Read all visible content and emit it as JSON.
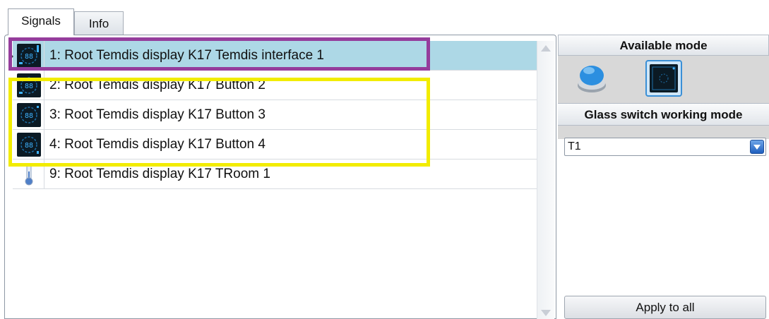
{
  "tabs": {
    "signals": "Signals",
    "info": "Info"
  },
  "signals": [
    {
      "label": "1: Root Temdis display K17 Temdis interface 1",
      "icon": "temdis-display-icon",
      "selected": true
    },
    {
      "label": "2: Root Temdis display K17 Button 2",
      "icon": "temdis-display-icon",
      "selected": false
    },
    {
      "label": "3: Root Temdis display K17 Button 3",
      "icon": "temdis-display-icon",
      "selected": false
    },
    {
      "label": "4: Root Temdis display K17 Button 4",
      "icon": "temdis-display-icon",
      "selected": false
    },
    {
      "label": "9: Root Temdis display K17 TRoom 1",
      "icon": "thermometer-icon",
      "selected": false
    }
  ],
  "side": {
    "available_mode_title": "Available mode",
    "modes": [
      {
        "icon": "push-button-icon",
        "active": false
      },
      {
        "icon": "glass-switch-icon",
        "active": true
      }
    ],
    "working_mode_title": "Glass switch working mode",
    "working_mode_value": "T1",
    "apply_label": "Apply to all"
  },
  "colors": {
    "selected_row": "#add8e6",
    "highlight_purple": "#953d9c",
    "highlight_yellow": "#f2ec00"
  }
}
